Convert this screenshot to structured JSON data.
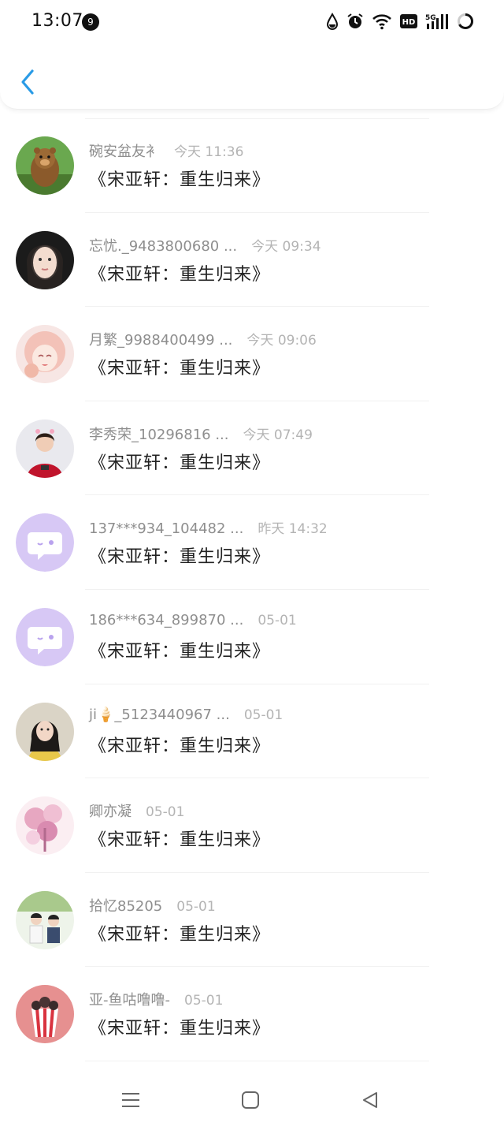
{
  "status_bar": {
    "time": "13:07",
    "notification_count": "9",
    "icons": [
      "water-drop-icon",
      "alarm-icon",
      "wifi-icon",
      "hd-icon",
      "5g-signal-icon",
      "battery-icon"
    ],
    "hd_label": "HD",
    "network_label": "5G"
  },
  "header": {
    "back_icon": "chevron-left-icon",
    "accent_color": "#2a9be6"
  },
  "messages": [
    {
      "name": "碗安盆友衤",
      "time": "今天 11:36",
      "text": "《宋亚轩：重生归来》",
      "avatar": "bear-cartoon"
    },
    {
      "name": "忘忧._9483800680 ...",
      "time": "今天 09:34",
      "text": "《宋亚轩：重生归来》",
      "avatar": "girl-portrait"
    },
    {
      "name": "月繁_9988400499 ...",
      "time": "今天 09:06",
      "text": "《宋亚轩：重生归来》",
      "avatar": "anime-girl"
    },
    {
      "name": "李秀荣_10296816 ...",
      "time": "今天 07:49",
      "text": "《宋亚轩：重生归来》",
      "avatar": "woman-red"
    },
    {
      "name": "137***934_104482 ...",
      "time": "昨天 14:32",
      "text": "《宋亚轩：重生归来》",
      "avatar": "default-chat-bubble"
    },
    {
      "name": "186***634_899870 ...",
      "time": "05-01",
      "text": "《宋亚轩：重生归来》",
      "avatar": "default-chat-bubble"
    },
    {
      "name": "ji🍦_5123440967 ...",
      "time": "05-01",
      "text": "《宋亚轩：重生归来》",
      "avatar": "girl-yellow"
    },
    {
      "name": "卿亦凝",
      "time": "05-01",
      "text": "《宋亚轩：重生归来》",
      "avatar": "pink-flowers"
    },
    {
      "name": "拾忆85205",
      "time": "05-01",
      "text": "《宋亚轩：重生归来》",
      "avatar": "two-boys"
    },
    {
      "name": "亚-鱼咕噜噜-",
      "time": "05-01",
      "text": "《宋亚轩：重生归来》",
      "avatar": "popcorn-cup"
    }
  ],
  "nav_bar": {
    "icons": [
      "menu-icon",
      "home-square-icon",
      "back-triangle-icon"
    ]
  }
}
